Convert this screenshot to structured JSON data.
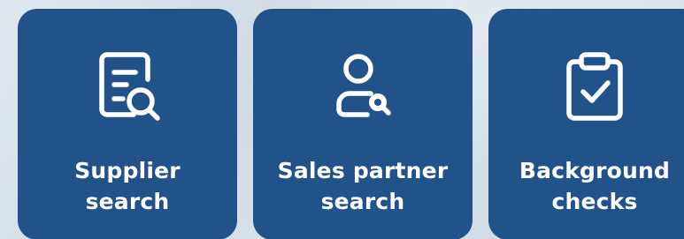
{
  "tiles": [
    {
      "icon": "document-search-icon",
      "line1": "Supplier",
      "line2": "search"
    },
    {
      "icon": "user-search-icon",
      "line1": "Sales partner",
      "line2": "search"
    },
    {
      "icon": "clipboard-check-icon",
      "line1": "Background",
      "line2": "checks"
    }
  ],
  "colors": {
    "tile_bg": "#22528a",
    "tile_text": "#ffffff",
    "page_bg": "#d6e0ea"
  }
}
